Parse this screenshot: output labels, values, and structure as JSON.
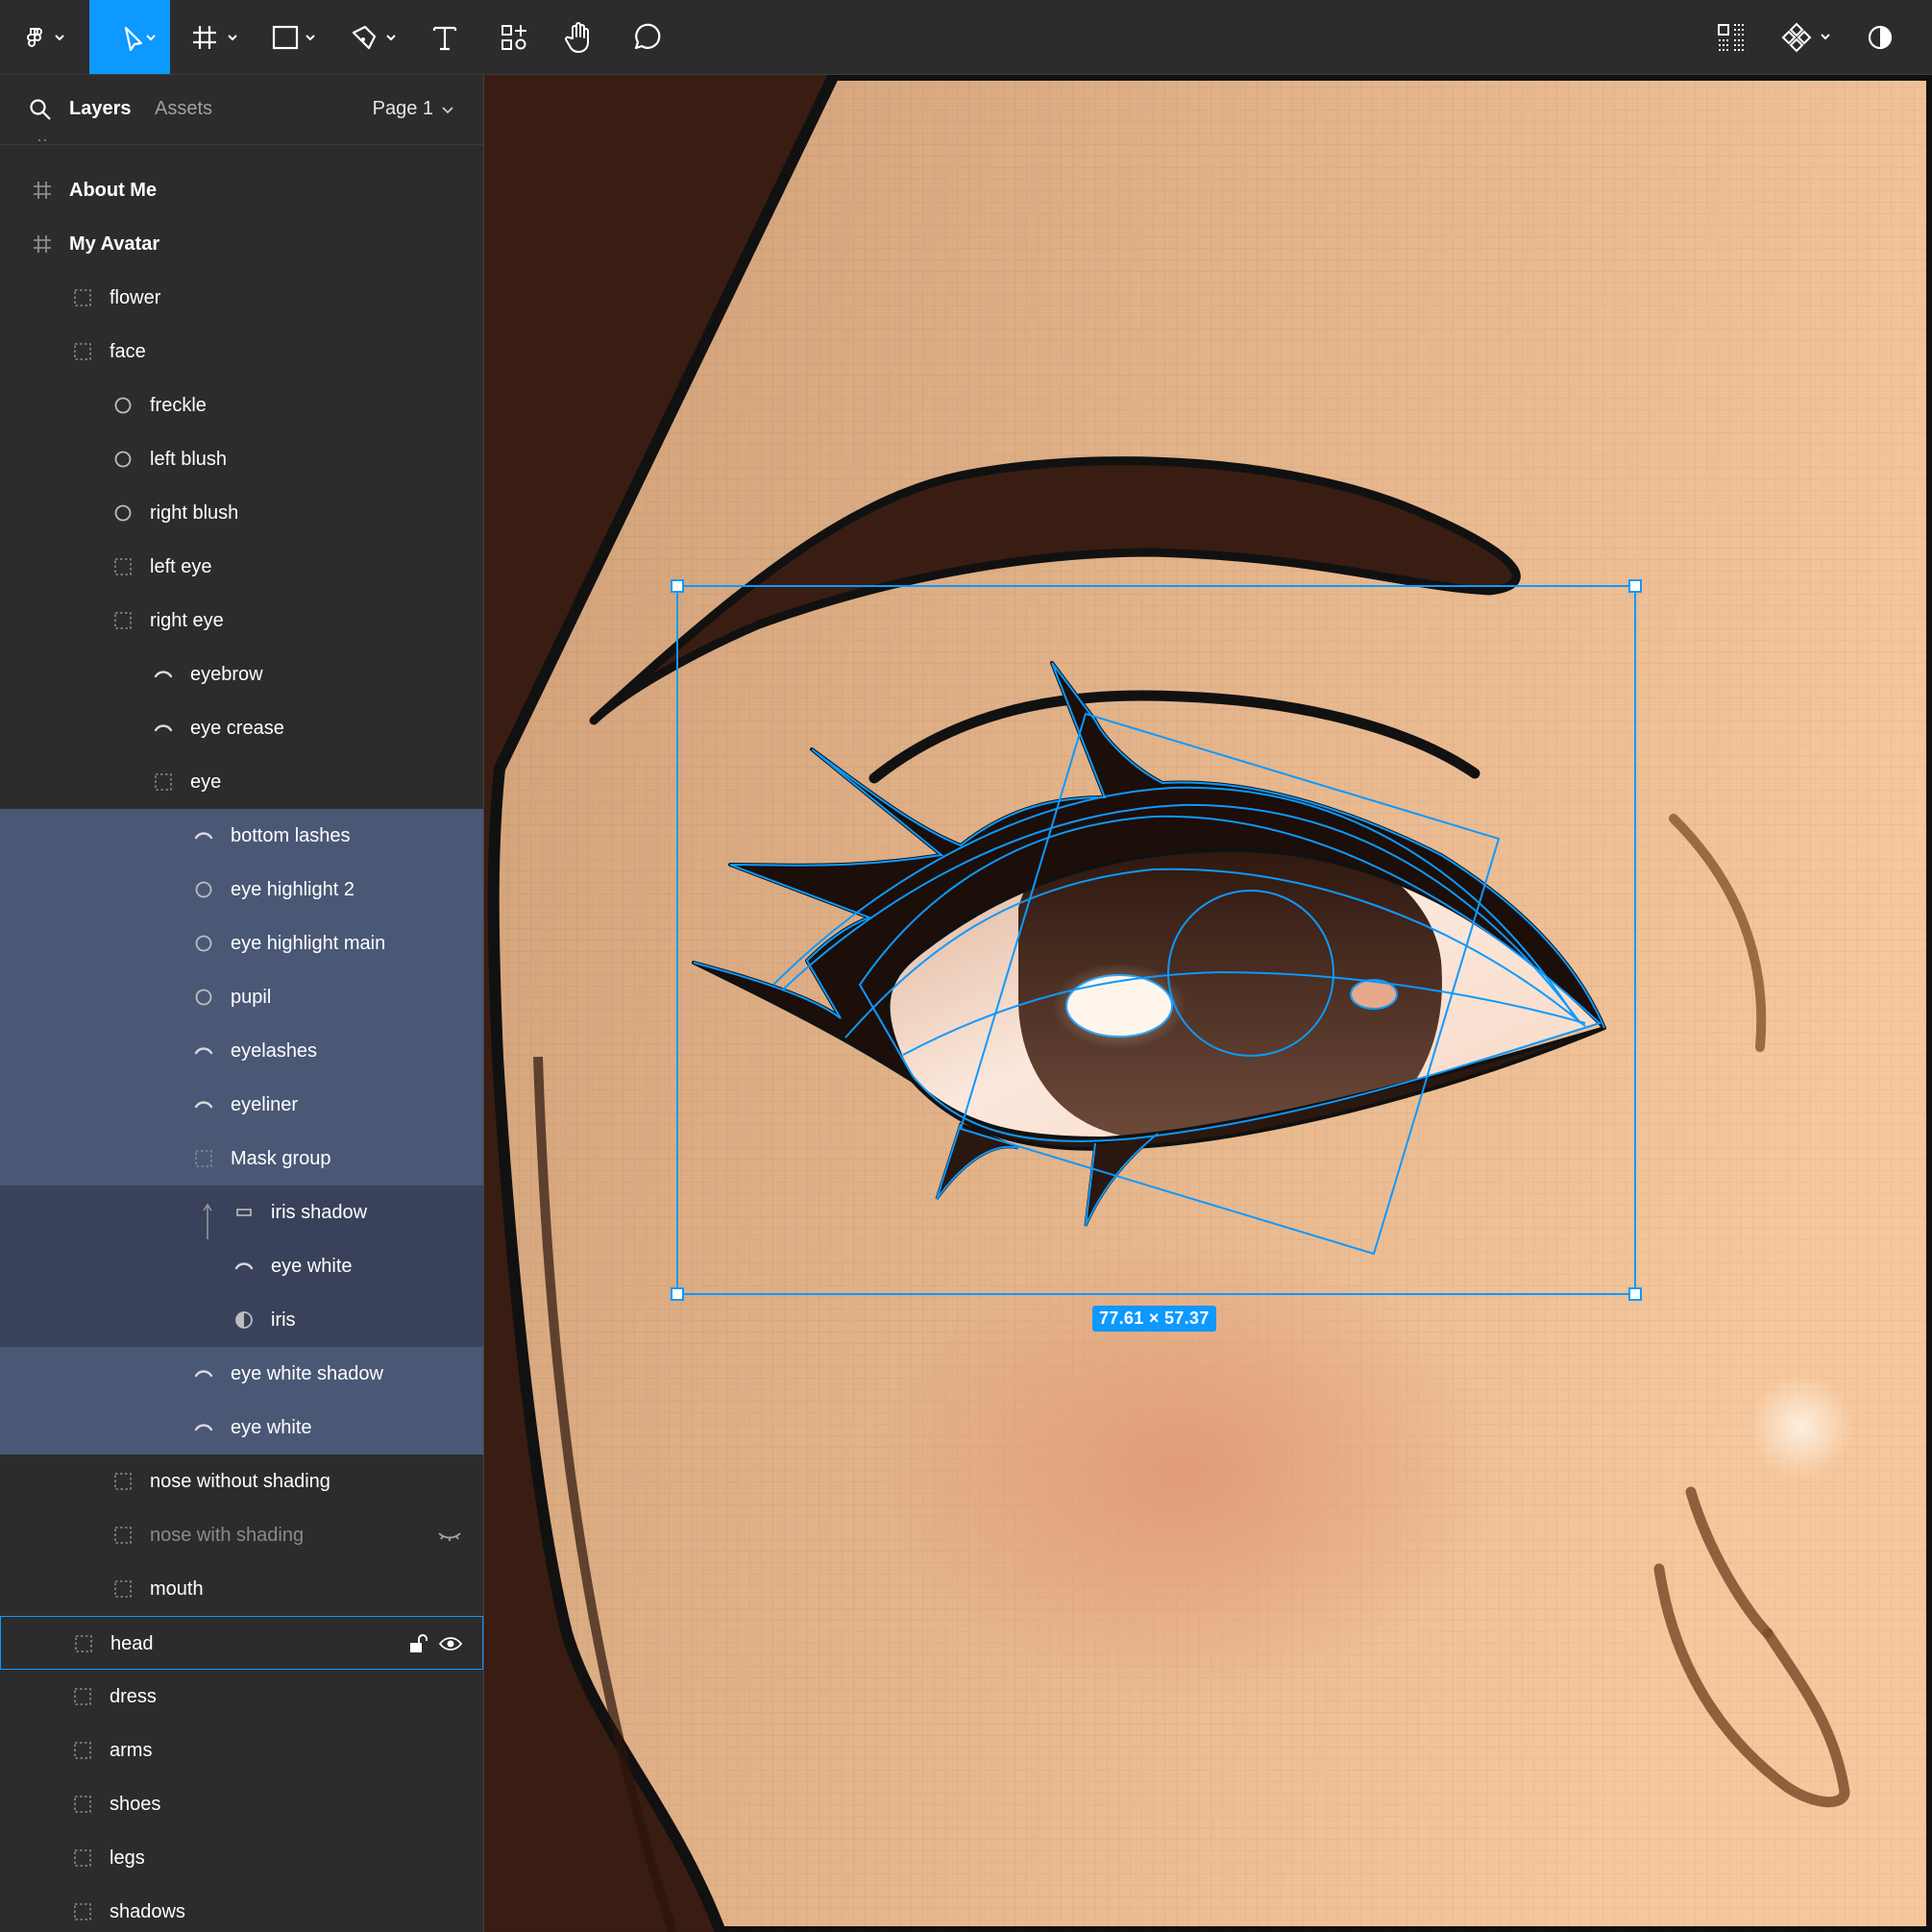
{
  "toolbar": {
    "tools": [
      "main-menu",
      "move-tool",
      "frame-tool",
      "shape-tool",
      "pen-tool",
      "text-tool",
      "resources-tool",
      "hand-tool",
      "comment-tool"
    ],
    "active_tool": "move-tool",
    "right_tools": [
      "multiplayer-grid",
      "component-tool",
      "contrast-toggle"
    ]
  },
  "panel": {
    "tabs": {
      "layers": "Layers",
      "assets": "Assets"
    },
    "page_selector": "Page 1",
    "layers": [
      {
        "label": "About Me",
        "icon": "frame-icon",
        "state": "normal"
      },
      {
        "label": "My Avatar",
        "icon": "frame-icon",
        "state": "normal"
      },
      {
        "label": "flower",
        "icon": "group-icon",
        "state": "normal"
      },
      {
        "label": "face",
        "icon": "group-icon",
        "state": "normal"
      },
      {
        "label": "freckle",
        "icon": "ellipse-icon",
        "state": "normal"
      },
      {
        "label": "left blush",
        "icon": "ellipse-icon",
        "state": "normal"
      },
      {
        "label": "right blush",
        "icon": "ellipse-icon",
        "state": "normal"
      },
      {
        "label": "left eye",
        "icon": "group-icon",
        "state": "normal"
      },
      {
        "label": "right eye",
        "icon": "group-icon",
        "state": "normal"
      },
      {
        "label": "eyebrow",
        "icon": "vector-icon",
        "state": "normal"
      },
      {
        "label": "eye crease",
        "icon": "vector-icon",
        "state": "normal"
      },
      {
        "label": "eye",
        "icon": "group-icon",
        "state": "normal"
      },
      {
        "label": "bottom lashes",
        "icon": "vector-icon",
        "state": "selected"
      },
      {
        "label": "eye highlight 2",
        "icon": "ellipse-icon",
        "state": "selected"
      },
      {
        "label": "eye highlight main",
        "icon": "ellipse-icon",
        "state": "selected"
      },
      {
        "label": "pupil",
        "icon": "ellipse-icon",
        "state": "selected"
      },
      {
        "label": "eyelashes",
        "icon": "vector-icon",
        "state": "selected"
      },
      {
        "label": "eyeliner",
        "icon": "vector-icon",
        "state": "selected"
      },
      {
        "label": "Mask group",
        "icon": "group-icon",
        "state": "selected"
      },
      {
        "label": "iris shadow",
        "icon": "rect-icon",
        "state": "selected-child"
      },
      {
        "label": "eye white",
        "icon": "vector-icon",
        "state": "selected-child"
      },
      {
        "label": "iris",
        "icon": "mask-icon",
        "state": "selected-child"
      },
      {
        "label": "eye white shadow",
        "icon": "vector-icon",
        "state": "selected"
      },
      {
        "label": "eye white",
        "icon": "vector-icon",
        "state": "selected"
      },
      {
        "label": "nose without shading",
        "icon": "group-icon",
        "state": "normal"
      },
      {
        "label": "nose with shading",
        "icon": "group-icon",
        "state": "hidden"
      },
      {
        "label": "mouth",
        "icon": "group-icon",
        "state": "normal"
      },
      {
        "label": "head",
        "icon": "group-icon",
        "state": "hover"
      },
      {
        "label": "dress",
        "icon": "group-icon",
        "state": "normal"
      },
      {
        "label": "arms",
        "icon": "group-icon",
        "state": "normal"
      },
      {
        "label": "shoes",
        "icon": "group-icon",
        "state": "normal"
      },
      {
        "label": "legs",
        "icon": "group-icon",
        "state": "normal"
      },
      {
        "label": "shadows",
        "icon": "group-icon",
        "state": "normal"
      }
    ]
  },
  "canvas": {
    "selection_size": "77.61 × 57.37"
  },
  "colors": {
    "accent": "#0d99ff",
    "selected_row": "#4a5876",
    "selected_child_row": "#39425a",
    "panel_bg": "#2c2c2c",
    "skin": "#dcae85",
    "hair": "#3a1d12"
  }
}
